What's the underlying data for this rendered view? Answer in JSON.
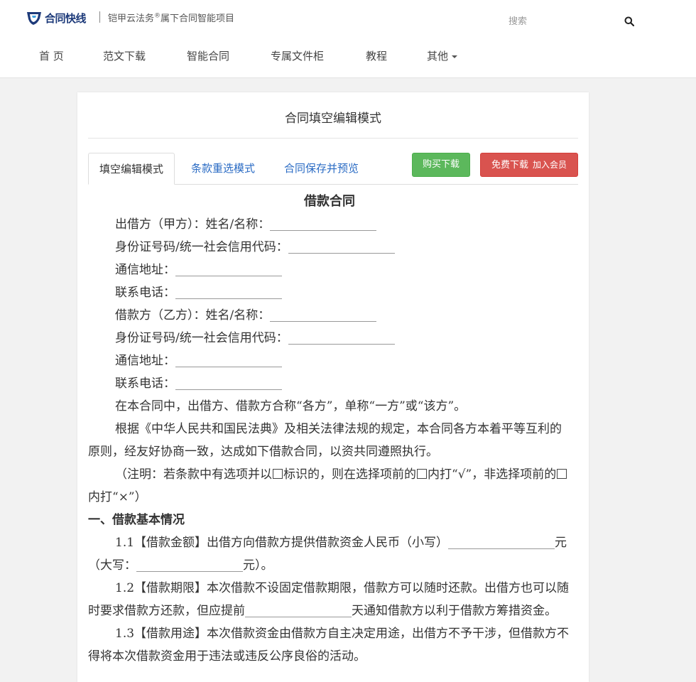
{
  "header": {
    "logo_text": "合同快线",
    "tagline_pre": "铠甲云法务",
    "tagline_sup": "®",
    "tagline_post": "属下合同智能项目",
    "search_placeholder": "搜索"
  },
  "nav": {
    "items": [
      "首 页",
      "范文下载",
      "智能合同",
      "专属文件柜",
      "教程",
      "其他"
    ]
  },
  "card": {
    "title": "合同填空编辑模式",
    "tabs": [
      "填空编辑模式",
      "条款重选模式",
      "合同保存并预览"
    ],
    "buy_label": "购买下载",
    "free_label": "免费下载",
    "free_sub": "加入会员"
  },
  "doc": {
    "title": "借款合同",
    "lender_name": "出借方（甲方）：姓名/名称：",
    "lender_id": "身份证号码/统一社会信用代码：",
    "lender_addr": "通信地址：",
    "lender_phone": "联系电话：",
    "borrower_name": "借款方（乙方）：姓名/名称：",
    "borrower_id": "身份证号码/统一社会信用代码：",
    "borrower_addr": "通信地址：",
    "borrower_phone": "联系电话：",
    "p1": "在本合同中，出借方、借款方合称“各方”，单称“一方”或“该方”。",
    "p2": "根据《中华人民共和国民法典》及相关法律法规的规定，本合同各方本着平等互利的原则，经友好协商一致，达成如下借款合同，以资共同遵照执行。",
    "note_a": "（注明：若条款中有选项并以",
    "note_b": "标识的，则在选择项前的",
    "note_c": "内打“√”，非选择项前的",
    "note_d": "内打“×”）",
    "s1": "一、借款基本情况",
    "c11_a": "1.1【借款金额】出借方向借款方提供借款资金人民币（小写）",
    "c11_b": "元（大写：",
    "c11_c": "元）。",
    "c12_a": "1.2【借款期限】本次借款不设固定借款期限，借款方可以随时还款。出借方也可以随时要求借款方还款，但应提前",
    "c12_b": "天通知借款方以利于借款方筹措资金。",
    "c13": "1.3【借款用途】本次借款资金由借款方自主决定用途，出借方不予干涉，但借款方不得将本次借款资金用于违法或违反公序良俗的活动。"
  },
  "colors": {
    "link": "#2a6bc4",
    "buy": "#5cb85c",
    "free": "#d9534f",
    "logo": "#1d3a7a"
  }
}
